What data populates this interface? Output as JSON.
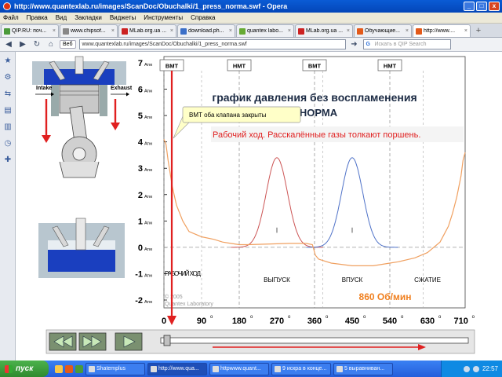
{
  "window": {
    "title": "http://www.quantexlab.ru/images/ScanDoc/Obuchalki/1_press_norma.swf - Opera",
    "buttons": [
      "_",
      "□",
      "x"
    ]
  },
  "menu": [
    "Файл",
    "Правка",
    "Вид",
    "Закладки",
    "Виджеты",
    "Инструменты",
    "Справка"
  ],
  "tabs": [
    {
      "label": "QIP.RU: поч...",
      "icon": "qip-icon",
      "color": "#4a9a3a"
    },
    {
      "label": "www.chipsof...",
      "icon": "page-icon",
      "color": "#888"
    },
    {
      "label": "MLab.org.ua ...",
      "icon": "mlab-icon",
      "color": "#c22"
    },
    {
      "label": "download.ph...",
      "icon": "page-icon",
      "color": "#3b6fc8"
    },
    {
      "label": "quantex labo...",
      "icon": "quantex-icon",
      "color": "#6a3"
    },
    {
      "label": "MLab.org.ua ...",
      "icon": "mlab-icon",
      "color": "#c22"
    },
    {
      "label": "Обучающие...",
      "icon": "opera-icon",
      "color": "#e35a1a"
    },
    {
      "label": "http://www....",
      "icon": "opera-icon",
      "color": "#e35a1a",
      "active": true
    }
  ],
  "addressbar": {
    "web_label": "Веб",
    "url": "www.quantexlab.ru/images/ScanDoc/Obuchalki/1_press_norma.swf",
    "search_placeholder": "Искать в QIP Search"
  },
  "engine": {
    "intake_label": "Intake",
    "exhaust_label": "Exhaust"
  },
  "chart_data": {
    "type": "line",
    "title": "график давления без воспламенения",
    "subtitle": "НОРМА",
    "stroke_note": "Рабочий ход. Расскалённые газы толкают поршень.",
    "tooltip": "ВМТ оба клапана закрыты",
    "rpm_label": "860 Об/мин",
    "copyright": [
      "© 2005",
      "Quantex Laboratory"
    ],
    "y_ticks": [
      {
        "value": 7,
        "label": "7",
        "unit": "Атм"
      },
      {
        "value": 6,
        "label": "6",
        "unit": "Атм"
      },
      {
        "value": 5,
        "label": "5",
        "unit": "Атм"
      },
      {
        "value": 4,
        "label": "4",
        "unit": "Атм"
      },
      {
        "value": 3,
        "label": "3",
        "unit": "Атм"
      },
      {
        "value": 2,
        "label": "2",
        "unit": "Атм"
      },
      {
        "value": 1,
        "label": "1",
        "unit": "Атм"
      },
      {
        "value": 0,
        "label": "0",
        "unit": "Атм"
      },
      {
        "value": -1,
        "label": "-1",
        "unit": "Атм"
      },
      {
        "value": -2,
        "label": "-2",
        "unit": "Атм"
      }
    ],
    "x_ticks": [
      {
        "value": 0,
        "label": "0"
      },
      {
        "value": 90,
        "label": "90"
      },
      {
        "value": 180,
        "label": "180"
      },
      {
        "value": 270,
        "label": "270"
      },
      {
        "value": 360,
        "label": "360"
      },
      {
        "value": 450,
        "label": "450"
      },
      {
        "value": 540,
        "label": "540"
      },
      {
        "value": 630,
        "label": "630"
      },
      {
        "value": 710,
        "label": "710"
      }
    ],
    "degree_symbol": "o",
    "xlim": [
      0,
      720
    ],
    "ylim": [
      -2,
      7
    ],
    "tdc_markers": [
      {
        "x": 0,
        "label": "ВМТ"
      },
      {
        "x": 180,
        "label": "НМТ"
      },
      {
        "x": 360,
        "label": "ВМТ"
      },
      {
        "x": 540,
        "label": "НМТ"
      }
    ],
    "strokes": [
      {
        "label": "РАБОЧИЙ ХОД",
        "from": 0,
        "to": 90
      },
      {
        "label": "ВЫПУСК",
        "from": 180,
        "to": 360
      },
      {
        "label": "ВПУСК",
        "from": 360,
        "to": 540
      },
      {
        "label": "СЖАТИЕ",
        "from": 540,
        "to": 720
      }
    ],
    "series": [
      {
        "name": "pressure",
        "color": "#f0a060",
        "x": [
          0,
          5,
          10,
          20,
          30,
          45,
          60,
          90,
          120,
          140,
          160,
          180,
          200,
          240,
          300,
          340,
          355,
          362,
          370,
          380,
          400,
          450,
          500,
          540,
          560,
          600,
          630,
          660,
          680,
          690,
          700,
          710,
          715,
          720
        ],
        "y": [
          4.1,
          3.9,
          3.3,
          2.3,
          1.6,
          1.0,
          0.6,
          0.4,
          0.3,
          0.2,
          0.15,
          0.1,
          0.1,
          0.12,
          0.15,
          0.15,
          0.1,
          -0.3,
          -0.45,
          -0.5,
          -0.6,
          -0.7,
          -0.7,
          -0.6,
          -0.55,
          -0.4,
          -0.2,
          0.2,
          0.8,
          1.3,
          1.9,
          2.7,
          3.3,
          3.6
        ]
      },
      {
        "name": "valve-exhaust",
        "color": "#cc5555",
        "center": 270,
        "peak": 3.4,
        "width": 100
      },
      {
        "name": "valve-intake",
        "color": "#4f72c8",
        "center": 450,
        "peak": 3.4,
        "width": 100
      }
    ],
    "cursor_angle": 0
  },
  "playback": {
    "rewind": "rewind",
    "forward": "fast-forward",
    "play": "play",
    "progress": 0.0
  },
  "taskbar": {
    "start": "пуск",
    "tasks": [
      {
        "label": "Shatemplus",
        "active": false
      },
      {
        "label": "http://www.qua...",
        "active": true
      },
      {
        "label": "httpwww.quant...",
        "active": false
      },
      {
        "label": "9 искра в конце...",
        "active": false
      },
      {
        "label": "5 выравниван...",
        "active": false
      }
    ],
    "clock": "22:57"
  }
}
